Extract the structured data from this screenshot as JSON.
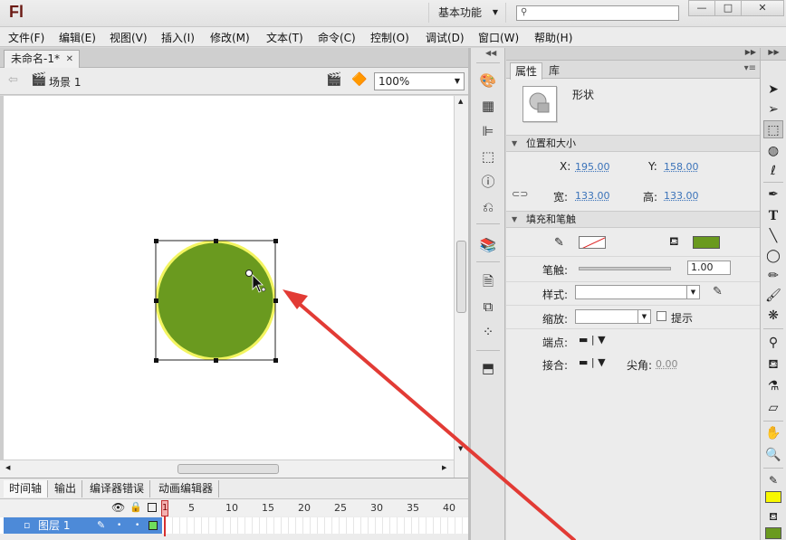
{
  "app": {
    "logo": "Fl",
    "workspace": "基本功能",
    "search_placeholder": ""
  },
  "window_controls": {
    "minimize": "—",
    "maximize": "□",
    "close": "✕"
  },
  "menu": [
    "文件(F)",
    "编辑(E)",
    "视图(V)",
    "插入(I)",
    "修改(M)",
    "文本(T)",
    "命令(C)",
    "控制(O)",
    "调试(D)",
    "窗口(W)",
    "帮助(H)"
  ],
  "document": {
    "tab_title": "未命名-1*",
    "scene": "场景 1",
    "zoom": "100%"
  },
  "shape": {
    "fill_color": "#6a9a1f",
    "highlight_color": "#f3f560"
  },
  "timeline": {
    "tabs": [
      "时间轴",
      "输出",
      "编译器错误",
      "动画编辑器"
    ],
    "frame_numbers": [
      "5",
      "10",
      "15",
      "20",
      "25",
      "30",
      "35",
      "40"
    ],
    "playhead": "1",
    "layer": "图层 1"
  },
  "properties": {
    "tabs": [
      "属性",
      "库"
    ],
    "object_type": "形状",
    "section_position": "位置和大小",
    "x_label": "X:",
    "x_value": "195.00",
    "y_label": "Y:",
    "y_value": "158.00",
    "w_label": "宽:",
    "w_value": "133.00",
    "h_label": "高:",
    "h_value": "133.00",
    "section_fill": "填充和笔触",
    "fill_color": "#6a9a1f",
    "stroke_label": "笔触:",
    "stroke_value": "1.00",
    "style_label": "样式:",
    "scale_label": "缩放:",
    "hint_label": "提示",
    "cap_label": "端点:",
    "join_label": "接合:",
    "miter_label": "尖角:",
    "miter_value": "0.00"
  },
  "toolbar": {
    "fill_swatch": "#f8f800",
    "stroke_swatch": "#6a9a1f"
  },
  "annotation": {
    "arrow_color": "#e23b35"
  }
}
